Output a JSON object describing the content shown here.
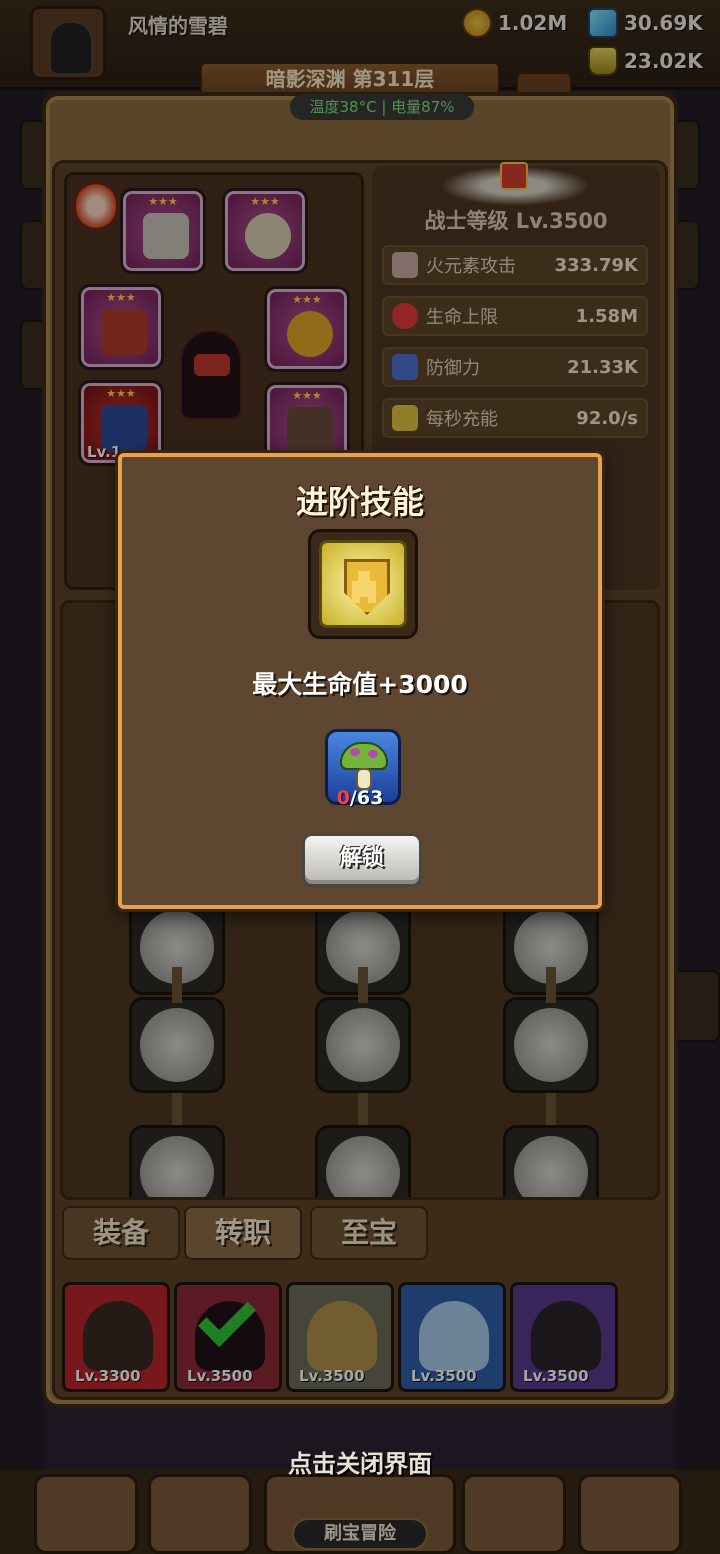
{
  "header": {
    "username": "风情的雪碧",
    "gold": "1.02M",
    "gems": "30.69K",
    "potion": "23.02K",
    "stage": "暗影深渊 第311层"
  },
  "status_bar": "温度38°C | 电量87%",
  "hero": {
    "equipment_slots": [
      {
        "name": "sword",
        "stars": "★★★"
      },
      {
        "name": "necklace",
        "stars": "★★★"
      },
      {
        "name": "helmet",
        "stars": "★★★"
      },
      {
        "name": "ring",
        "stars": "★★★"
      },
      {
        "name": "armor",
        "stars": "★★★",
        "level": "Lv.1"
      },
      {
        "name": "boots",
        "stars": "★★★"
      }
    ]
  },
  "stats": {
    "warrior_level": "战士等级 Lv.3500",
    "rows": [
      {
        "label": "火元素攻击",
        "value": "333.79K",
        "icon": "fire-attack-icon",
        "color": "#c8a9a0"
      },
      {
        "label": "生命上限",
        "value": "1.58M",
        "icon": "heart-icon",
        "color": "#e03a3a"
      },
      {
        "label": "防御力",
        "value": "21.33K",
        "icon": "shield-icon",
        "color": "#4f6fd0"
      },
      {
        "label": "每秒充能",
        "value": "92.0/s",
        "icon": "lightning-icon",
        "color": "#e0c040"
      }
    ]
  },
  "tabs": [
    {
      "label": "装备",
      "active": false
    },
    {
      "label": "转职",
      "active": true
    },
    {
      "label": "至宝",
      "active": false
    }
  ],
  "heroes": [
    {
      "level": "Lv.3300",
      "color": "#b8262c"
    },
    {
      "level": "Lv.3500",
      "color": "#8a2a3a",
      "selected": true
    },
    {
      "level": "Lv.3500",
      "color": "#6b6a5a"
    },
    {
      "level": "Lv.3500",
      "color": "#2f5fa8"
    },
    {
      "level": "Lv.3500",
      "color": "#5a3a8a"
    }
  ],
  "close_hint": "点击关闭界面",
  "adventure_label": "刷宝冒险",
  "modal": {
    "title": "进阶技能",
    "skill_icon": "gold-shield-plus-icon",
    "description": "最大生命值+3000",
    "material_icon": "mushroom-icon",
    "material_have": "0",
    "material_need": "/63",
    "unlock_label": "解锁"
  },
  "colors": {
    "accent_border": "#e8a24a",
    "status_text": "#7fe07a",
    "shortage_text": "#ff4040"
  }
}
